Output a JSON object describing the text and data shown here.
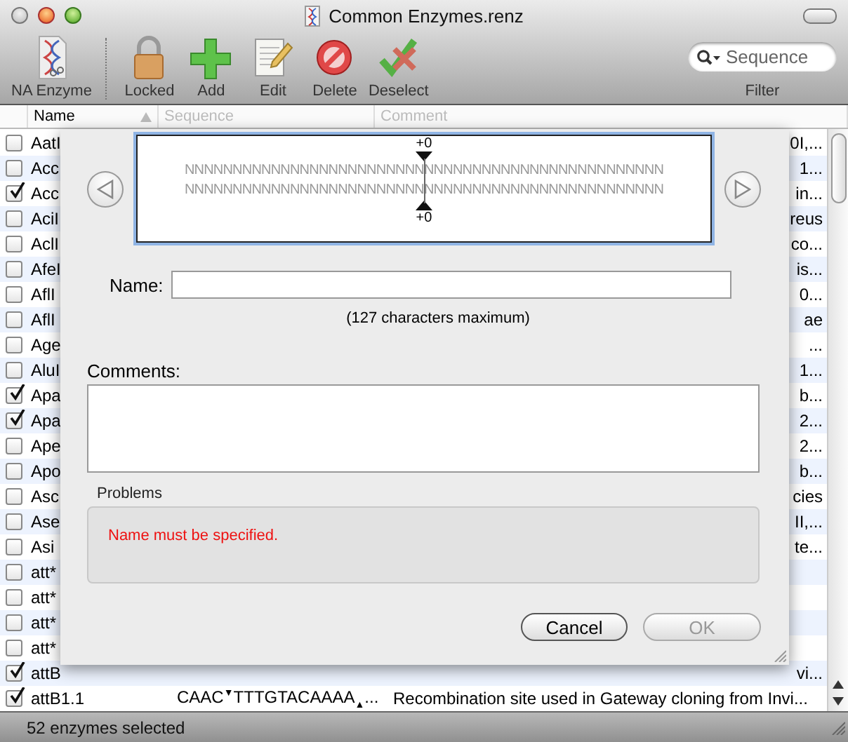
{
  "window": {
    "title": "Common Enzymes.renz"
  },
  "toolbar": {
    "items": [
      {
        "label": "NA Enzyme",
        "kind": "document"
      },
      {
        "label": "Locked",
        "kind": "lock"
      },
      {
        "label": "Add",
        "kind": "add"
      },
      {
        "label": "Edit",
        "kind": "edit"
      },
      {
        "label": "Delete",
        "kind": "delete"
      },
      {
        "label": "Deselect",
        "kind": "deselect"
      }
    ],
    "search": {
      "placeholder": "Sequence",
      "label": "Filter"
    }
  },
  "table": {
    "columns": [
      "Name",
      "Sequence",
      "Comment"
    ],
    "rows": [
      {
        "name": "AatI",
        "checked": false,
        "comment": "0I,..."
      },
      {
        "name": "Acc",
        "checked": false,
        "comment": "1..."
      },
      {
        "name": "Acc",
        "checked": true,
        "comment": "in..."
      },
      {
        "name": "AciI",
        "checked": false,
        "comment": "reus"
      },
      {
        "name": "AclI",
        "checked": false,
        "comment": "co..."
      },
      {
        "name": "AfeI",
        "checked": false,
        "comment": "is..."
      },
      {
        "name": "AflI",
        "checked": false,
        "comment": "0..."
      },
      {
        "name": "AflI",
        "checked": false,
        "comment": "ae"
      },
      {
        "name": "Age",
        "checked": false,
        "comment": "..."
      },
      {
        "name": "AluI",
        "checked": false,
        "comment": "1..."
      },
      {
        "name": "Apa",
        "checked": true,
        "comment": "b..."
      },
      {
        "name": "Apa",
        "checked": true,
        "comment": "2..."
      },
      {
        "name": "Ape",
        "checked": false,
        "comment": "2..."
      },
      {
        "name": "Apo",
        "checked": false,
        "comment": "b..."
      },
      {
        "name": "Asc",
        "checked": false,
        "comment": "cies"
      },
      {
        "name": "Ase",
        "checked": false,
        "comment": "II,..."
      },
      {
        "name": "Asi",
        "checked": false,
        "comment": "te..."
      },
      {
        "name": "att*",
        "checked": false
      },
      {
        "name": "att*",
        "checked": false
      },
      {
        "name": "att*",
        "checked": false
      },
      {
        "name": "att*",
        "checked": false
      },
      {
        "name": "attB",
        "checked": true,
        "comment": "vi..."
      },
      {
        "name": "attB1.1",
        "checked": true,
        "sequence": "CAAC$^{▼}$TTTGTACAAAA$_{▲}$...",
        "comment": "Recombination site used in Gateway cloning from Invi..."
      }
    ]
  },
  "sheet": {
    "sequence_view": {
      "top_offset": "+0",
      "bottom_offset": "+0",
      "lines": [
        "NNNNNNNNNNNNNNNNNNNNNNNNNNNNNNNNNNNNNNNNNNNNNNNNNN",
        "NNNNNNNNNNNNNNNNNNNNNNNNNNNNNNNNNNNNNNNNNNNNNNNNNN"
      ]
    },
    "name_label": "Name:",
    "name_hint": "(127 characters maximum)",
    "comments_label": "Comments:",
    "problems": {
      "title": "Problems",
      "message": "Name must be specified."
    },
    "buttons": [
      {
        "label": "Cancel",
        "disabled": false
      },
      {
        "label": "OK",
        "disabled": true
      }
    ]
  },
  "status_bar": "52 enzymes selected"
}
